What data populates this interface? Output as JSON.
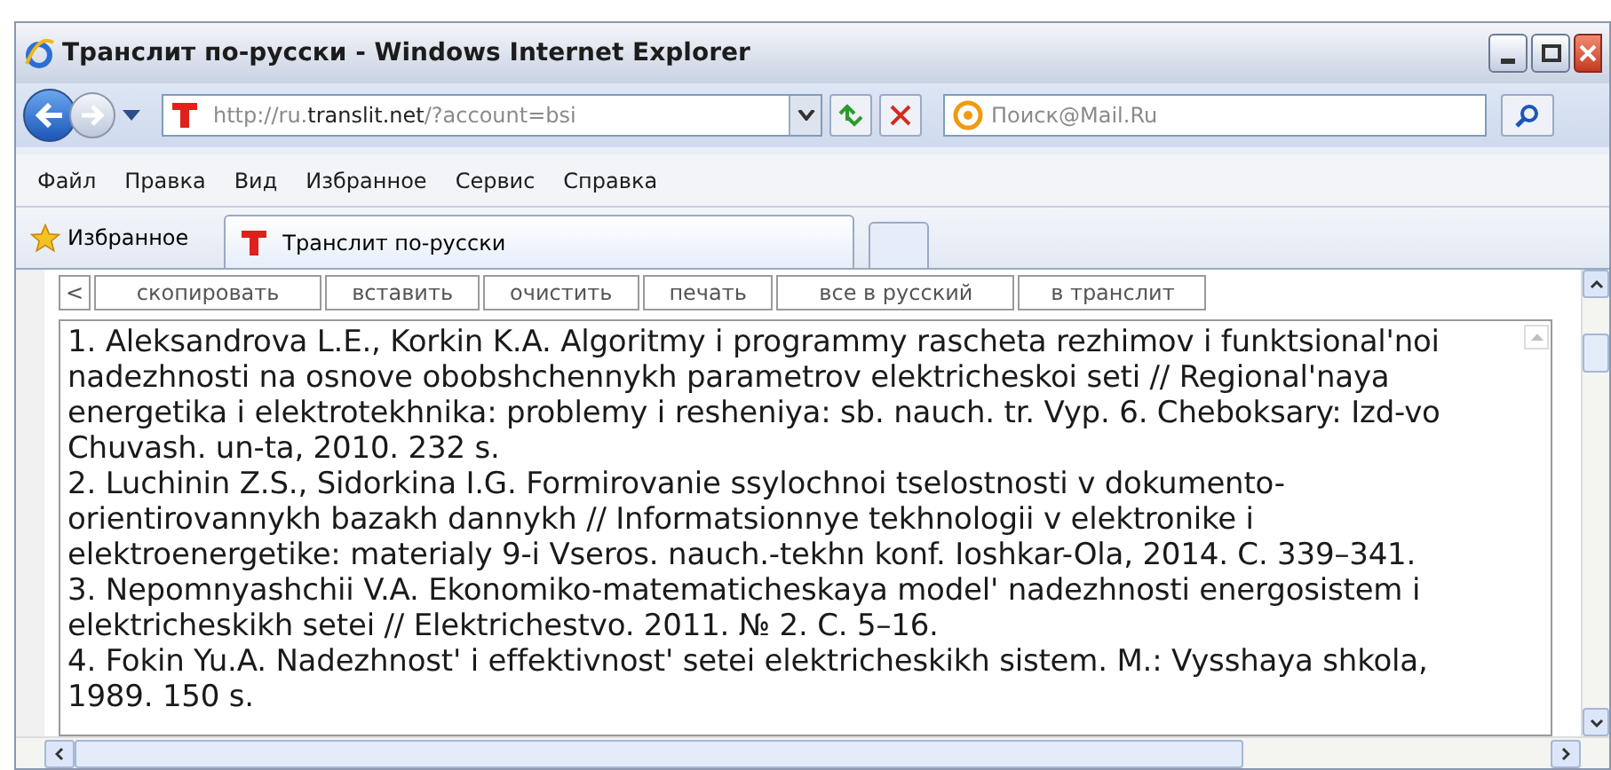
{
  "window": {
    "title": "Транслит по-русски - Windows Internet Explorer"
  },
  "address": {
    "prefix": "http://ru.",
    "host": "translit.net",
    "path": "/?account=bsi"
  },
  "search": {
    "placeholder": "Поиск@Mail.Ru"
  },
  "menu": [
    "Файл",
    "Правка",
    "Вид",
    "Избранное",
    "Сервис",
    "Справка"
  ],
  "favorites": {
    "label": "Избранное"
  },
  "tabs": [
    {
      "label": "Транслит по-русски",
      "selected": true
    }
  ],
  "toolbar": {
    "collapse": "<",
    "buttons": [
      "скопировать",
      "вставить",
      "очистить",
      "печать",
      "все в русский",
      "в транслит"
    ]
  },
  "references": [
    {
      "lines": [
        "1. Aleksandrova L.E., Korkin K.A. Algoritmy i programmy rascheta rezhimov i funktsional'noi",
        "nadezhnosti na osnove obobshchennykh parametrov elektricheskoi seti // Regional'naya",
        "energetika i elektrotekhnika: problemy i resheniya: sb. nauch. tr. Vyp. 6. Cheboksary: Izd-vo",
        "Chuvash. un-ta, 2010. 232 s."
      ]
    },
    {
      "lines": [
        "2. Luchinin Z.S., Sidorkina I.G. Formirovanie ssylochnoi tselostnosti v dokumento-",
        "orientirovannykh bazakh dannykh // Informatsionnye tekhnologii v elektronike i",
        "elektroenergetike: materialy 9-i Vseros. nauch.-tekhn konf. Ioshkar-Ola, 2014. C. 339–341."
      ]
    },
    {
      "lines": [
        "3. Nepomnyashchii V.A. Ekonomiko-matematicheskaya model' nadezhnosti energosistem i",
        "elektricheskikh setei // Elektrichestvo. 2011. № 2. C. 5–16."
      ]
    },
    {
      "lines": [
        "4. Fokin Yu.A. Nadezhnost' i effektivnost' setei elektricheskikh sistem. M.: Vysshaya shkola,",
        "1989. 150 s."
      ]
    }
  ]
}
